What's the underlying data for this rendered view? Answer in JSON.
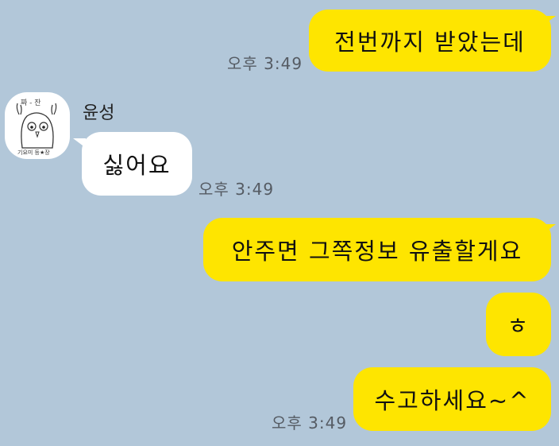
{
  "chat": {
    "messages": [
      {
        "side": "me",
        "text": "전번까지 받았는데",
        "time": "오후 3:49"
      },
      {
        "side": "other",
        "sender": "윤성",
        "text": "싫어요",
        "time": "오후 3:49"
      },
      {
        "side": "me",
        "text": "안주면 그쪽정보 유출할게요"
      },
      {
        "side": "me",
        "text": "ㅎ"
      },
      {
        "side": "me",
        "text": "수고하세요~^",
        "time": "오후 3:49"
      }
    ],
    "avatar": {
      "icon": "owl-sketch-icon",
      "top_caption": "짜 - 잔",
      "bottom_caption": "기요미 등★장"
    }
  }
}
